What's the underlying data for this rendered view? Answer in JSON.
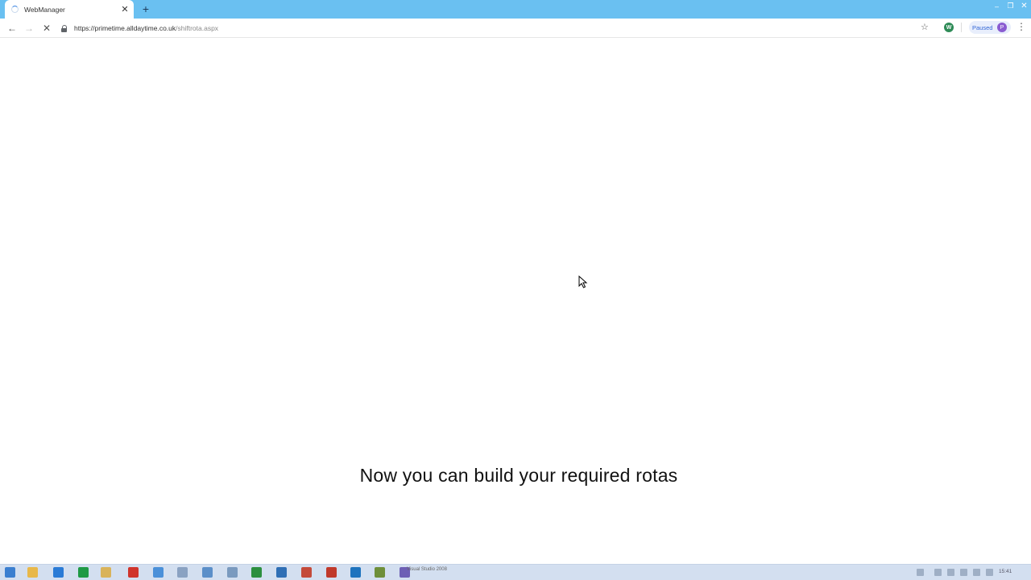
{
  "browser": {
    "tab_title": "WebManager",
    "url_host": "https://primetime.alldaytime.co.uk",
    "url_path": "/shiftrota.aspx",
    "paused_label": "Paused",
    "avatar_initial": "P",
    "extension_letter": "W"
  },
  "page": {
    "caption": "Now you can build your required rotas"
  },
  "taskbar": {
    "label": "Visual Studio 2008",
    "clock": "15:41"
  },
  "colors": {
    "titlebar": "#6ac0f1",
    "taskbar": "#d3dff0",
    "loading_spinner": "#2f7de1"
  },
  "icons": {
    "back": "arrow-left-icon",
    "forward": "arrow-right-icon",
    "stop": "close-icon",
    "lock": "lock-icon",
    "bookmark": "star-icon",
    "menu": "kebab-menu-icon",
    "new_tab": "plus-icon"
  }
}
